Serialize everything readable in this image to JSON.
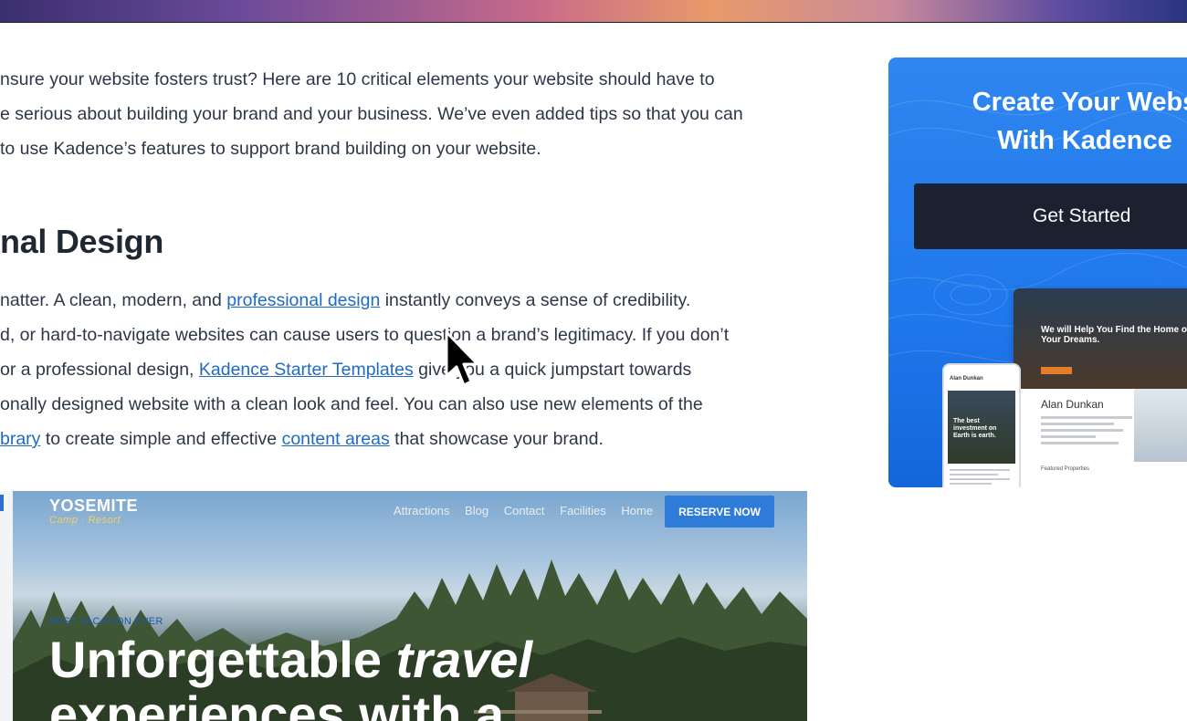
{
  "article": {
    "intro_lines": [
      "nsure your website fosters trust? Here are 10 critical elements your website should have to",
      "e serious about building your brand and your business. We’ve even added tips so that you can",
      "to use Kadence’s features to support brand building on your website."
    ],
    "heading": "nal Design",
    "body": {
      "l1_a": "natter. A clean, modern, and ",
      "l1_link": "professional design",
      "l1_b": " instantly conveys a sense of credibility.",
      "l2": "d, or hard-to-navigate websites can cause users to question a brand’s legitimacy. If you don’t",
      "l3_a": "or a professional design, ",
      "l3_link": "Kadence Starter Templates",
      "l3_b": " give you a quick jumpstart towards",
      "l4": "onally designed website with a clean look and feel. You can also use new elements of the",
      "l5_link1": "brary",
      "l5_a": " to create simple and effective ",
      "l5_link2": "content areas",
      "l5_b": " that showcase your brand."
    }
  },
  "ad": {
    "title_line1": "Create Your Webs",
    "title_line2": "With Kadence",
    "button": "Get Started",
    "mock": {
      "hero_text": "We will Help You Find the Home of Your Dreams.",
      "name": "Alan Dunkan",
      "featured": "Featured Properties",
      "phone_name": "Alan Dunkan",
      "phone_hero": "The best investment on Earth is earth."
    }
  },
  "screenshot": {
    "logo": "YOSEMITE",
    "logo_sub": "Camp · Resort",
    "nav": [
      "Attractions",
      "Blog",
      "Contact",
      "Facilities",
      "Home"
    ],
    "cta": "RESERVE NOW",
    "eyebrow": "BEST VACATION EVER",
    "title_a": "Unforgettable ",
    "title_em": "travel",
    "title_line2": "experiences with a"
  },
  "colors": {
    "link": "#1e6bc4",
    "ad_blue": "#1f78ec",
    "button_dark": "#1c2130",
    "reserve_blue": "#2e7cd8"
  }
}
